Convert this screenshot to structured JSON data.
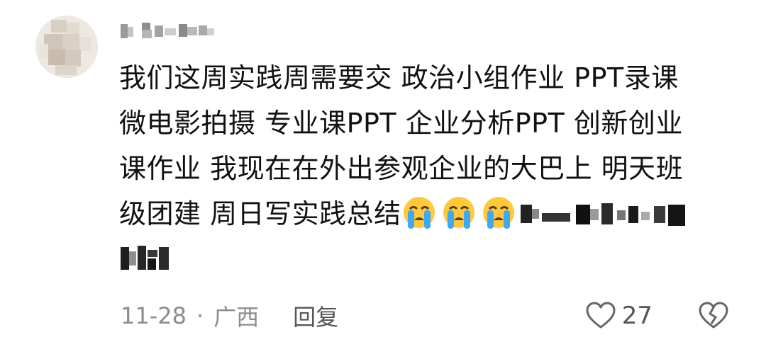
{
  "comment": {
    "username": "",
    "lines": [
      "我们这周实践周需要交 政治小组作业 PPT录课",
      "微电影拍摄 专业课PPT 企业分析PPT 创新创业",
      "课作业 我现在在外出参观企业的大巴上 明天班",
      "级团建 周日写实践总结"
    ],
    "emoji": [
      "loudly-crying-face",
      "loudly-crying-face",
      "loudly-crying-face"
    ],
    "date": "11-28",
    "separator": "·",
    "location": "广西",
    "reply_label": "回复",
    "like_count": "27",
    "icons": {
      "like": "heart-outline-icon",
      "dislike": "broken-heart-icon"
    },
    "colors": {
      "text": "#111111",
      "meta": "#8c8c8c",
      "icon": "#666666",
      "emoji_face": "#ffc83d",
      "emoji_tears": "#3fa9f5"
    }
  }
}
